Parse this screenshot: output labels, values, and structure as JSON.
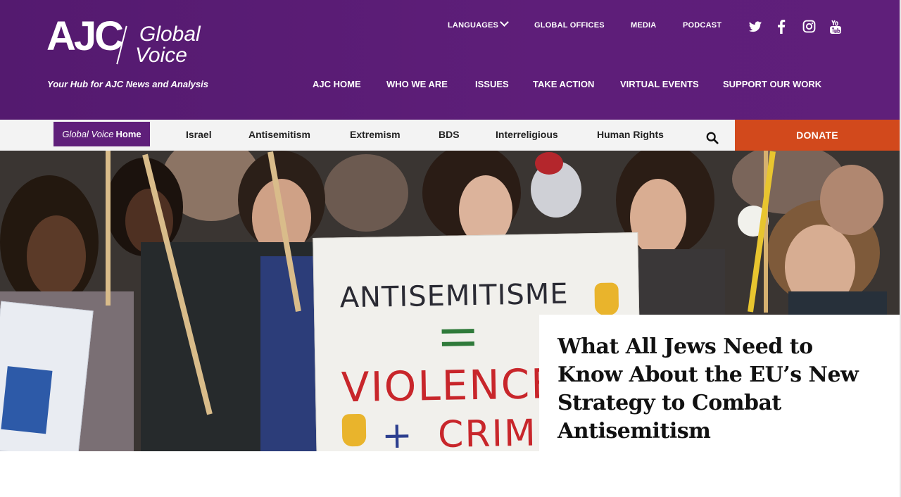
{
  "logo": {
    "brand": "AJC",
    "line1": "Global",
    "line2": "Voice"
  },
  "tagline": "Your Hub for AJC News and Analysis",
  "utility_nav": [
    {
      "label": "LANGUAGES",
      "has_dropdown": true
    },
    {
      "label": "GLOBAL OFFICES"
    },
    {
      "label": "MEDIA"
    },
    {
      "label": "PODCAST"
    }
  ],
  "social_icons": [
    "twitter-icon",
    "facebook-icon",
    "instagram-icon",
    "youtube-icon"
  ],
  "main_nav": [
    {
      "label": "AJC HOME"
    },
    {
      "label": "WHO WE ARE"
    },
    {
      "label": "ISSUES"
    },
    {
      "label": "TAKE ACTION"
    },
    {
      "label": "VIRTUAL EVENTS"
    },
    {
      "label": "SUPPORT OUR WORK"
    }
  ],
  "subnav": {
    "home_italic": "Global Voice",
    "home_bold": "Home",
    "items": [
      "Israel",
      "Antisemitism",
      "Extremism",
      "BDS",
      "Interreligious",
      "Human Rights"
    ],
    "search_icon": "search-icon",
    "donate": "DONATE"
  },
  "hero": {
    "sign_line1": "ANTISEMITISME",
    "sign_line2": "VIOLENCE",
    "sign_line3": "CRIME",
    "headline": "What All Jews Need to Know About the EU’s New Strategy to Combat Antisemitism"
  },
  "colors": {
    "header_purple": "#5e1e79",
    "donate_orange": "#d2491c",
    "subnav_bg": "#f3f3f3"
  }
}
